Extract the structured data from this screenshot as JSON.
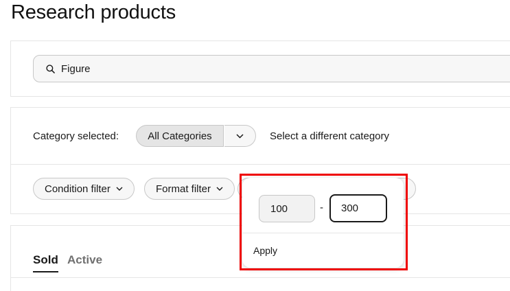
{
  "page": {
    "title": "Research products"
  },
  "search": {
    "value": "Figure",
    "icon": "search-icon"
  },
  "category": {
    "label": "Category selected:",
    "selected": "All Categories",
    "dropdown_icon": "chevron-down-icon",
    "change_link": "Select a different category"
  },
  "filters": [
    {
      "label": "Condition filter",
      "icon": "chevron-down-icon"
    },
    {
      "label": "Format filter",
      "icon": "chevron-down-icon"
    }
  ],
  "tabs": {
    "sold": "Sold",
    "active": "Active"
  },
  "price_popup": {
    "min_value": "100",
    "separator": "-",
    "max_value": "300",
    "apply_label": "Apply"
  },
  "colors": {
    "highlight": "#ef0000",
    "text": "#191919",
    "muted": "#707070",
    "pill_bg": "#f7f7f7",
    "border": "#c7c7c7"
  }
}
